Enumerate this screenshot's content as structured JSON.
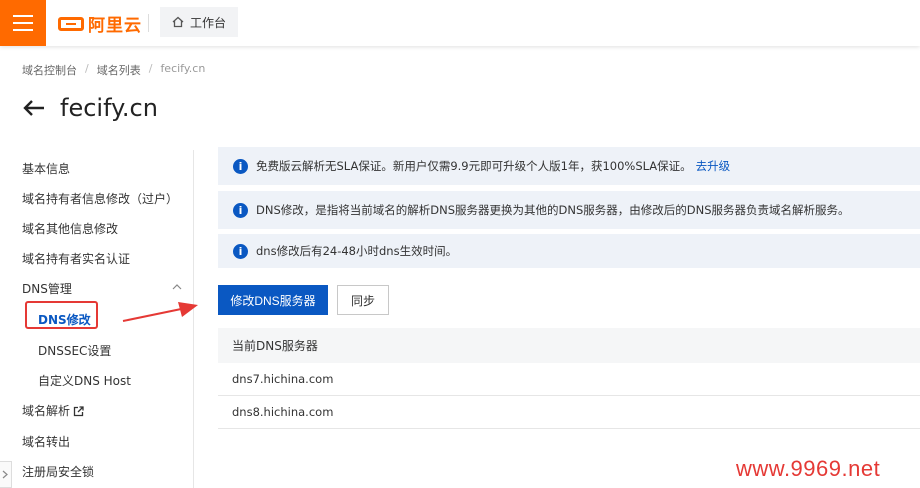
{
  "header": {
    "brand": "阿里云",
    "workbench_label": "工作台"
  },
  "breadcrumb": [
    "域名控制台",
    "域名列表",
    "fecify.cn"
  ],
  "page": {
    "title": "fecify.cn"
  },
  "sidebar": {
    "items": [
      "基本信息",
      "域名持有者信息修改（过户）",
      "域名其他信息修改",
      "域名持有者实名认证",
      "DNS管理",
      "DNS修改",
      "DNSSEC设置",
      "自定义DNS Host",
      "域名解析",
      "域名转出",
      "注册局安全锁"
    ]
  },
  "notices": [
    {
      "text": "免费版云解析无SLA保证。新用户仅需9.9元即可升级个人版1年，获100%SLA保证。",
      "link": "去升级"
    },
    {
      "text": "DNS修改，是指将当前域名的解析DNS服务器更换为其他的DNS服务器，由修改后的DNS服务器负责域名解析服务。"
    },
    {
      "text": "dns修改后有24-48小时dns生效时间。"
    }
  ],
  "actions": {
    "modify_label": "修改DNS服务器",
    "sync_label": "同步"
  },
  "table": {
    "header": "当前DNS服务器",
    "rows": [
      "dns7.hichina.com",
      "dns8.hichina.com"
    ]
  },
  "watermark": "www.9969.net",
  "colors": {
    "brand": "#ff6a00",
    "primary": "#0a58c2",
    "annotation": "#e53935"
  }
}
